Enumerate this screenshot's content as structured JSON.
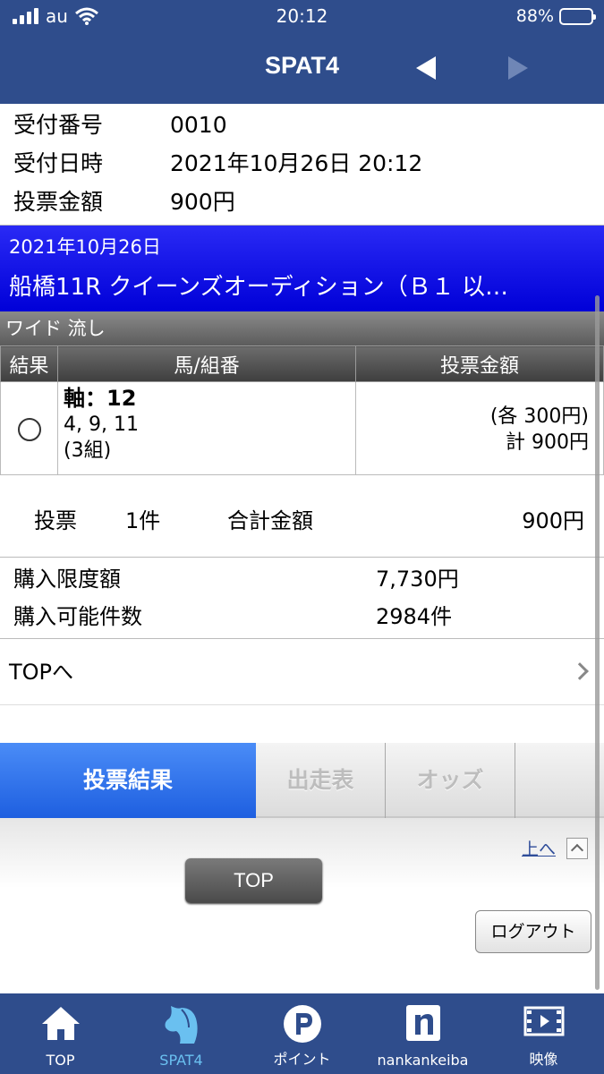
{
  "status_bar": {
    "carrier": "au",
    "time": "20:12",
    "battery": "88%",
    "battery_level": 0.88
  },
  "nav": {
    "title": "SPAT4"
  },
  "receipt": [
    {
      "label": "受付番号",
      "value": "0010"
    },
    {
      "label": "受付日時",
      "value": "2021年10月26日 20:12"
    },
    {
      "label": "投票金額",
      "value": "900円"
    }
  ],
  "race": {
    "date": "2021年10月26日",
    "name": "船橋11R クイーンズオーディション（Ｂ１ 以…"
  },
  "bet_type": "ワイド 流し",
  "table": {
    "headers": [
      "結果",
      "馬/組番",
      "投票金額"
    ],
    "row": {
      "axis": "軸：12",
      "horses": "4, 9, 11",
      "combos": "(3組)",
      "each": "(各 300円)",
      "total": "計 900円"
    }
  },
  "summary": {
    "count_label": "投票",
    "count": "1件",
    "total_label": "合計金額",
    "total": "900円"
  },
  "limits": [
    {
      "label": "購入限度額",
      "value": "7,730円"
    },
    {
      "label": "購入可能件数",
      "value": "2984件"
    }
  ],
  "top_link": "TOPへ",
  "tabs": [
    "投票結果",
    "出走表",
    "オッズ"
  ],
  "footer": {
    "to_top": "上へ",
    "top_button": "TOP",
    "logout_button": "ログアウト"
  },
  "tabbar": [
    "TOP",
    "SPAT4",
    "ポイント",
    "nankankeiba",
    "映像"
  ]
}
